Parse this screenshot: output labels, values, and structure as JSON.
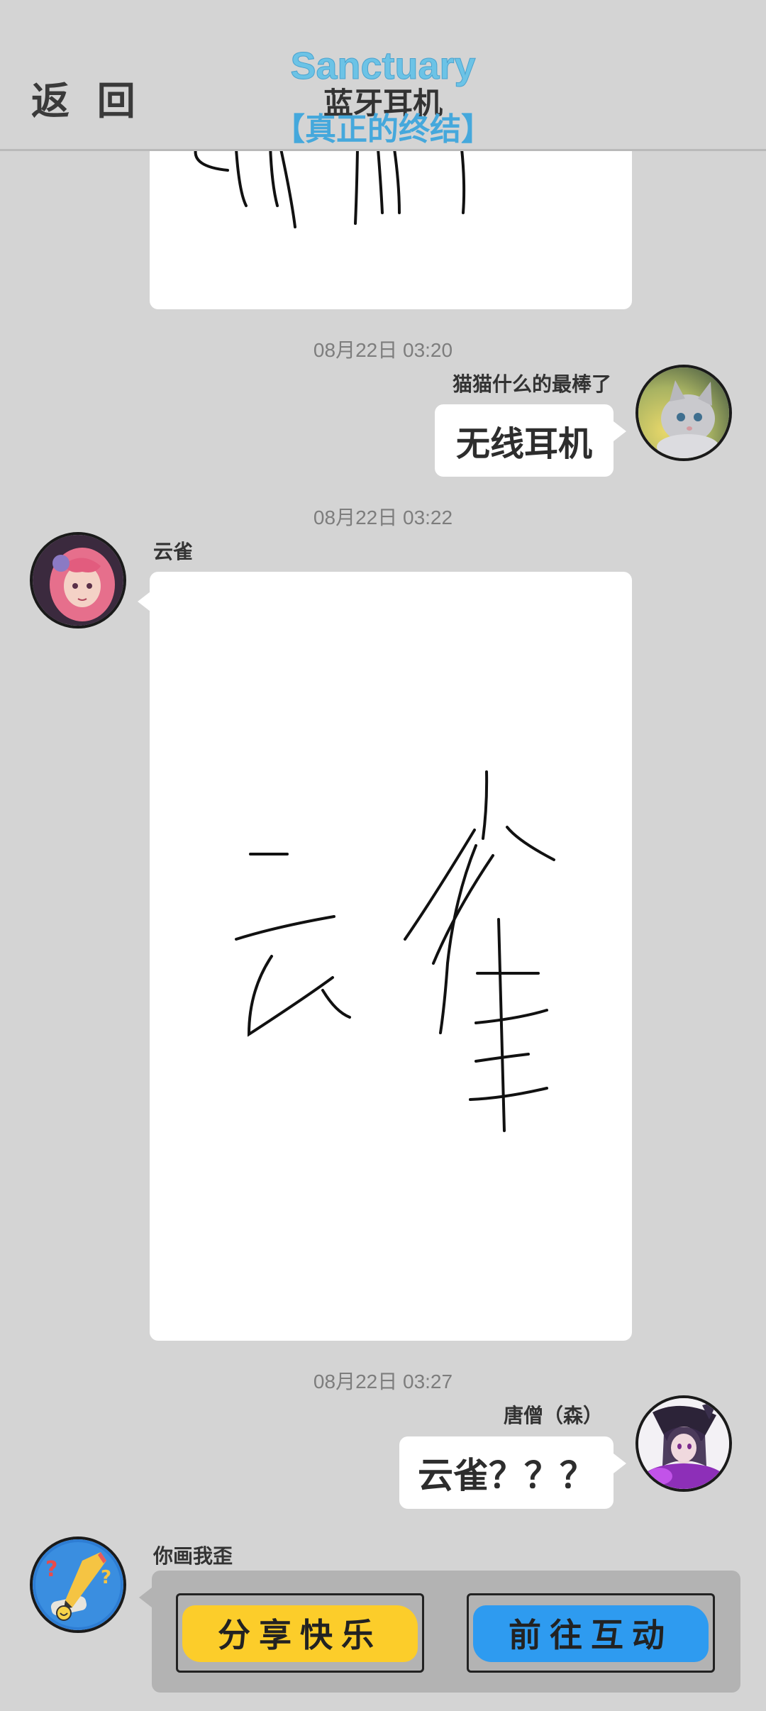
{
  "header": {
    "back_label": "返 回",
    "title": "Sanctuary",
    "subtitle_line1": "蓝牙耳机",
    "subtitle_line2": "【真正的终结】"
  },
  "messages": [
    {
      "timestamp": "08月22日  03:20",
      "sender": "猫猫什么的最棒了",
      "text": "无线耳机",
      "side": "right",
      "avatar": "cat-avatar"
    },
    {
      "timestamp": "08月22日  03:22",
      "sender": "云雀",
      "drawing": "云雀",
      "side": "left",
      "avatar": "anime-girl-avatar"
    },
    {
      "timestamp": "08月22日  03:27",
      "sender": "唐僧（森）",
      "text": "云雀？？？",
      "side": "right",
      "avatar": "dark-anime-avatar"
    },
    {
      "sender": "你画我歪",
      "side": "left",
      "avatar": "pencil-game-avatar"
    }
  ],
  "game_card": {
    "share_label": "分享快乐",
    "go_label": "前往互动",
    "share_color": "#fccd2a",
    "go_color": "#2e9bf0"
  },
  "colors": {
    "background": "#d4d4d4",
    "title_blue": "#6cc3e6",
    "bubble": "#ffffff"
  }
}
